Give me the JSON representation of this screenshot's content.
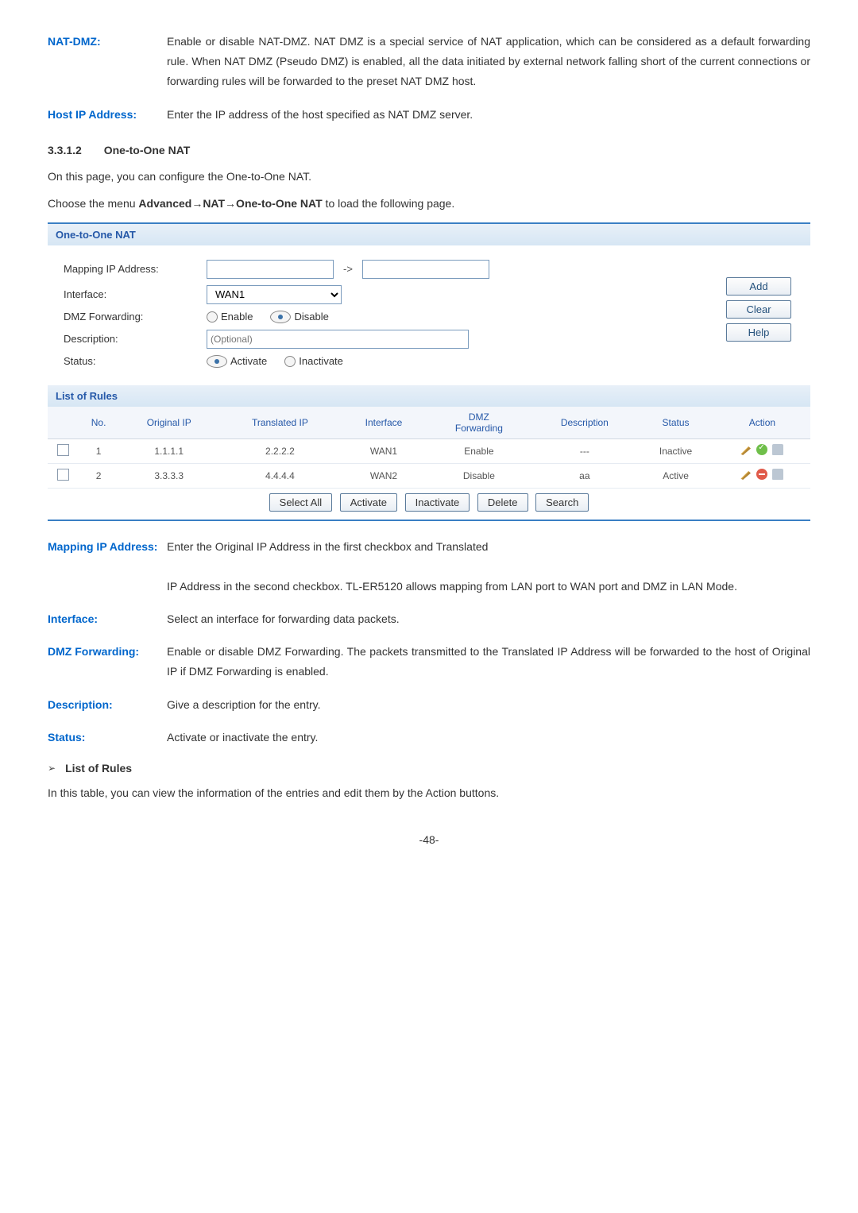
{
  "defs": {
    "nat_dmz": {
      "label": "NAT-DMZ:",
      "text": "Enable or disable NAT-DMZ. NAT DMZ is a special service of NAT application, which can be considered as a default forwarding rule. When NAT DMZ (Pseudo DMZ) is enabled, all the data initiated by external network falling short of the current connections or forwarding rules will be forwarded to the preset NAT DMZ host."
    },
    "host_ip": {
      "label": "Host IP Address:",
      "text": "Enter the IP address of the host specified as NAT DMZ server."
    }
  },
  "section": {
    "num": "3.3.1.2",
    "title": "One-to-One NAT",
    "intro": "On this page, you can configure the One-to-One NAT.",
    "nav_prefix": "Choose the menu ",
    "nav_bold": "Advanced→NAT→One-to-One NAT",
    "nav_suffix": " to load the following page."
  },
  "panel": {
    "title": "One-to-One NAT",
    "labels": {
      "mapping": "Mapping IP Address:",
      "interface": "Interface:",
      "dmz_fwd": "DMZ Forwarding:",
      "description": "Description:",
      "status": "Status:"
    },
    "arrow": "->",
    "interface_value": "WAN1",
    "radios": {
      "enable": "Enable",
      "disable": "Disable",
      "activate": "Activate",
      "inactivate": "Inactivate"
    },
    "desc_placeholder": "(Optional)",
    "buttons": {
      "add": "Add",
      "clear": "Clear",
      "help": "Help",
      "select_all": "Select All",
      "activate": "Activate",
      "inactivate": "Inactivate",
      "delete": "Delete",
      "search": "Search"
    },
    "list_title": "List of Rules",
    "columns": {
      "no": "No.",
      "orig": "Original IP",
      "trans": "Translated IP",
      "iface": "Interface",
      "dmz": "DMZ\nForwarding",
      "desc": "Description",
      "status": "Status",
      "action": "Action"
    },
    "rows": [
      {
        "no": "1",
        "orig": "1.1.1.1",
        "trans": "2.2.2.2",
        "iface": "WAN1",
        "dmz": "Enable",
        "desc": "---",
        "status": "Inactive"
      },
      {
        "no": "2",
        "orig": "3.3.3.3",
        "trans": "4.4.4.4",
        "iface": "WAN2",
        "dmz": "Disable",
        "desc": "aa",
        "status": "Active"
      }
    ]
  },
  "defs2": {
    "mapping": {
      "label": "Mapping IP Address:",
      "line1": "Enter the Original IP Address in the first checkbox and Translated",
      "line2": "IP Address in the second checkbox. TL-ER5120 allows mapping from LAN port to WAN port and DMZ in LAN Mode."
    },
    "interface": {
      "label": "Interface:",
      "text": "Select an interface for forwarding data packets."
    },
    "dmz": {
      "label": "DMZ Forwarding:",
      "text": "Enable or disable DMZ Forwarding. The packets transmitted to the Translated IP Address will be forwarded to the host of Original IP if DMZ Forwarding is enabled."
    },
    "description": {
      "label": "Description:",
      "text": "Give a description for the entry."
    },
    "status": {
      "label": "Status:",
      "text": "Activate or inactivate the entry."
    }
  },
  "list_rules": {
    "heading": "List of Rules",
    "text": "In this table, you can view the information of the entries and edit them by the Action buttons."
  },
  "page_number": "-48-"
}
